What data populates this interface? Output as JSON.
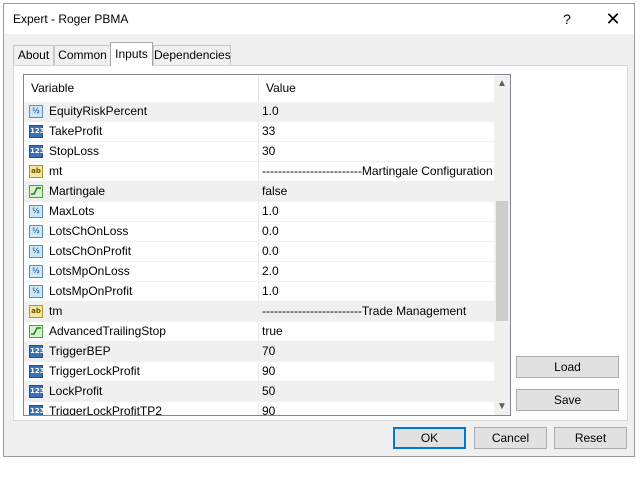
{
  "window": {
    "title": "Expert - Roger PBMA",
    "help_label": "?",
    "close_label": "✕"
  },
  "tabs": [
    {
      "label": "About"
    },
    {
      "label": "Common"
    },
    {
      "label": "Inputs",
      "active": true
    },
    {
      "label": "Dependencies"
    }
  ],
  "grid": {
    "headers": {
      "variable": "Variable",
      "value": "Value"
    },
    "rows": [
      {
        "icon": "double",
        "icon_text": "½",
        "name": "EquityRiskPercent",
        "value": "1.0",
        "selected": true
      },
      {
        "icon": "int",
        "icon_text": "123",
        "name": "TakeProfit",
        "value": "33"
      },
      {
        "icon": "int",
        "icon_text": "123",
        "name": "StopLoss",
        "value": "30"
      },
      {
        "icon": "string",
        "icon_text": "ab",
        "name": "mt",
        "value": "-------------------------Martingale Configuration"
      },
      {
        "icon": "bool",
        "icon_text": "",
        "name": "Martingale",
        "value": "false",
        "selected": true
      },
      {
        "icon": "double",
        "icon_text": "½",
        "name": "MaxLots",
        "value": "1.0"
      },
      {
        "icon": "double",
        "icon_text": "½",
        "name": "LotsChOnLoss",
        "value": "0.0"
      },
      {
        "icon": "double",
        "icon_text": "½",
        "name": "LotsChOnProfit",
        "value": "0.0"
      },
      {
        "icon": "double",
        "icon_text": "½",
        "name": "LotsMpOnLoss",
        "value": "2.0"
      },
      {
        "icon": "double",
        "icon_text": "½",
        "name": "LotsMpOnProfit",
        "value": "1.0"
      },
      {
        "icon": "string",
        "icon_text": "ab",
        "name": "tm",
        "value": "-------------------------Trade Management",
        "selected": true
      },
      {
        "icon": "bool",
        "icon_text": "",
        "name": "AdvancedTrailingStop",
        "value": "true"
      },
      {
        "icon": "int",
        "icon_text": "123",
        "name": "TriggerBEP",
        "value": "70",
        "selected": true
      },
      {
        "icon": "int",
        "icon_text": "123",
        "name": "TriggerLockProfit",
        "value": "90"
      },
      {
        "icon": "int",
        "icon_text": "123",
        "name": "LockProfit",
        "value": "50",
        "selected": true
      },
      {
        "icon": "int",
        "icon_text": "123",
        "name": "TriggerLockProfitTP2",
        "value": "90"
      }
    ],
    "scroll_up": "▲",
    "scroll_down": "▼"
  },
  "side_buttons": {
    "load": "Load",
    "save": "Save"
  },
  "footer_buttons": {
    "ok": "OK",
    "cancel": "Cancel",
    "reset": "Reset"
  },
  "colors": {
    "accent": "#0078d7",
    "selected_row": "#f0f0f0",
    "int_icon": "#3b72b5",
    "bool_icon": "#4aa43c"
  }
}
